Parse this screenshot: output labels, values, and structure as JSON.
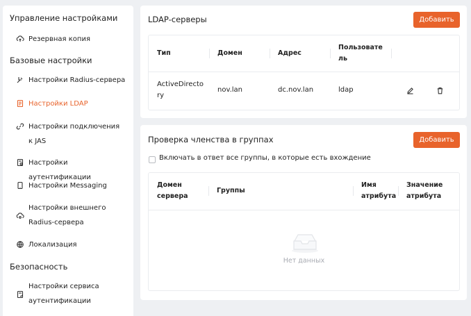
{
  "sidebar": {
    "sections": [
      {
        "title": "Управление настройками"
      },
      {
        "title": "Базовые настройки"
      },
      {
        "title": "Безопасность"
      }
    ],
    "items": [
      {
        "label": "Резервная копия",
        "icon": "backup-icon"
      },
      {
        "label": "Настройки Radius-сервера",
        "icon": "radius-icon"
      },
      {
        "label": "Настройки LDAP",
        "icon": "ldap-icon",
        "active": true
      },
      {
        "label": "Настройки подключения к JAS",
        "icon": "link-icon"
      },
      {
        "label": "Настройки аутентификации",
        "icon": "auth-icon"
      },
      {
        "label": "Настройки Messaging",
        "icon": "messaging-icon"
      },
      {
        "label": "Настройки внешнего Radius-сервера",
        "icon": "external-radius-icon"
      },
      {
        "label": "Локализация",
        "icon": "globe-icon"
      },
      {
        "label": "Настройки сервиса аутентификации",
        "icon": "auth-service-icon"
      }
    ]
  },
  "ldap": {
    "title": "LDAP-серверы",
    "add_label": "Добавить",
    "columns": [
      "Тип",
      "Домен",
      "Адрес",
      "Пользователь"
    ],
    "rows": [
      {
        "type": "ActiveDirectory",
        "domain": "nov.lan",
        "address": "dc.nov.lan",
        "user": "ldap"
      }
    ]
  },
  "groups": {
    "title": "Проверка членства в группах",
    "add_label": "Добавить",
    "checkbox_label": "Включать в ответ все группы, в которые есть вхождение",
    "columns": [
      "Домен сервера",
      "Группы",
      "Имя атрибута",
      "Значение атрибута"
    ],
    "empty_text": "Нет данных"
  },
  "colors": {
    "accent": "#e8632b",
    "background": "#eef0f3"
  }
}
